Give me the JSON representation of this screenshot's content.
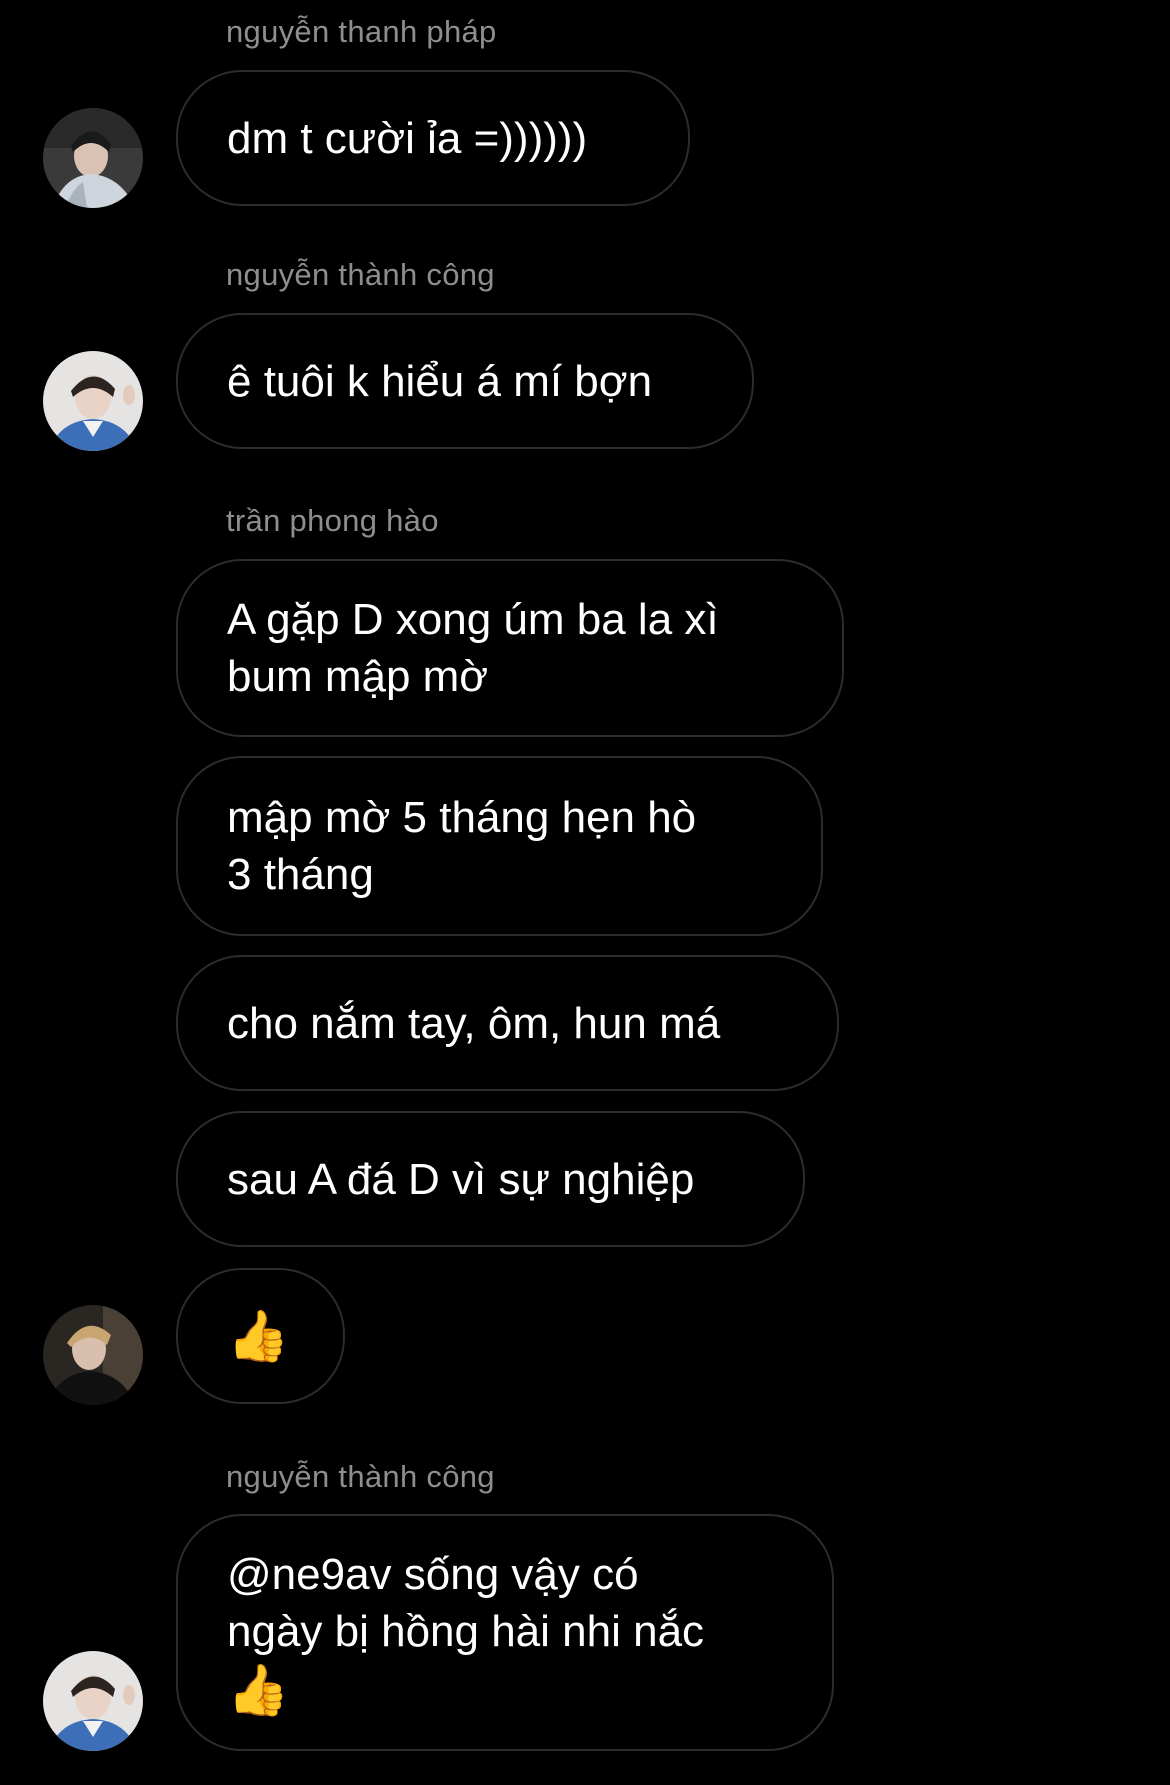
{
  "messages": [
    {
      "sender": "nguyễn thanh pháp",
      "lines": [
        "dm t cười ỉa =))))))"
      ]
    },
    {
      "sender": "nguyễn thành công",
      "lines": [
        "ê tuôi k hiểu á mí bợn"
      ]
    },
    {
      "sender": "trần phong hào",
      "lines": [
        "A gặp D xong úm ba la xì",
        "bum mập mờ"
      ]
    },
    {
      "lines": [
        "mập mờ 5 tháng hẹn hò",
        "3 tháng"
      ]
    },
    {
      "lines": [
        "cho nắm tay, ôm, hun má"
      ]
    },
    {
      "lines": [
        "sau A đá D vì sự nghiệp"
      ]
    },
    {
      "emoji": "👍"
    },
    {
      "sender": "nguyễn thành công",
      "lines": [
        "@ne9av sống vậy có",
        "ngày bị hồng hài nhi nắc"
      ],
      "emoji": "👍"
    }
  ],
  "avatars": [
    "avatar-thanh-phap",
    "avatar-thanh-cong",
    "avatar-phong-hao",
    "avatar-thanh-cong"
  ],
  "colors": {
    "background": "#000000",
    "bubble_border": "#2c2c2c",
    "sender_name": "#8e8e8e",
    "message_text": "#ffffff"
  }
}
